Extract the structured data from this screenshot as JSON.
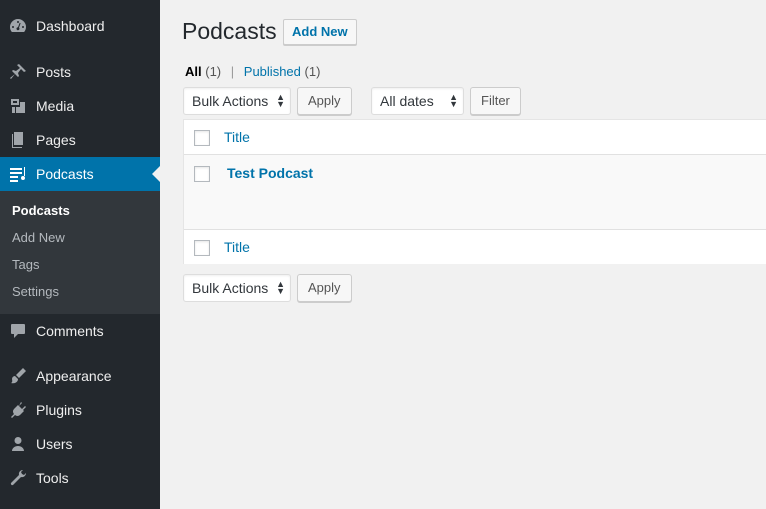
{
  "sidebar": {
    "items": [
      {
        "label": "Dashboard",
        "icon": "dashboard-icon"
      },
      {
        "label": "Posts",
        "icon": "pin-icon"
      },
      {
        "label": "Media",
        "icon": "media-icon"
      },
      {
        "label": "Pages",
        "icon": "pages-icon"
      },
      {
        "label": "Podcasts",
        "icon": "podcast-icon",
        "current": true
      },
      {
        "label": "Comments",
        "icon": "comment-icon"
      },
      {
        "label": "Appearance",
        "icon": "paintbrush-icon"
      },
      {
        "label": "Plugins",
        "icon": "plugin-icon"
      },
      {
        "label": "Users",
        "icon": "user-icon"
      },
      {
        "label": "Tools",
        "icon": "wrench-icon"
      }
    ],
    "submenu": [
      "Podcasts",
      "Add New",
      "Tags",
      "Settings"
    ]
  },
  "header": {
    "title": "Podcasts",
    "add_new": "Add New"
  },
  "filters": {
    "all_label": "All",
    "all_count": "(1)",
    "separator": "|",
    "published_label": "Published",
    "published_count": "(1)"
  },
  "tablenav_top": {
    "bulk_actions": "Bulk Actions",
    "apply": "Apply",
    "dates": "All dates",
    "filter": "Filter"
  },
  "table": {
    "column_title": "Title",
    "rows": [
      {
        "title": "Test Podcast"
      }
    ]
  },
  "tablenav_bottom": {
    "bulk_actions": "Bulk Actions",
    "apply": "Apply"
  },
  "colors": {
    "sidebar_bg": "#23282d",
    "submenu_bg": "#32373c",
    "accent": "#0073aa",
    "link": "#0073aa"
  }
}
